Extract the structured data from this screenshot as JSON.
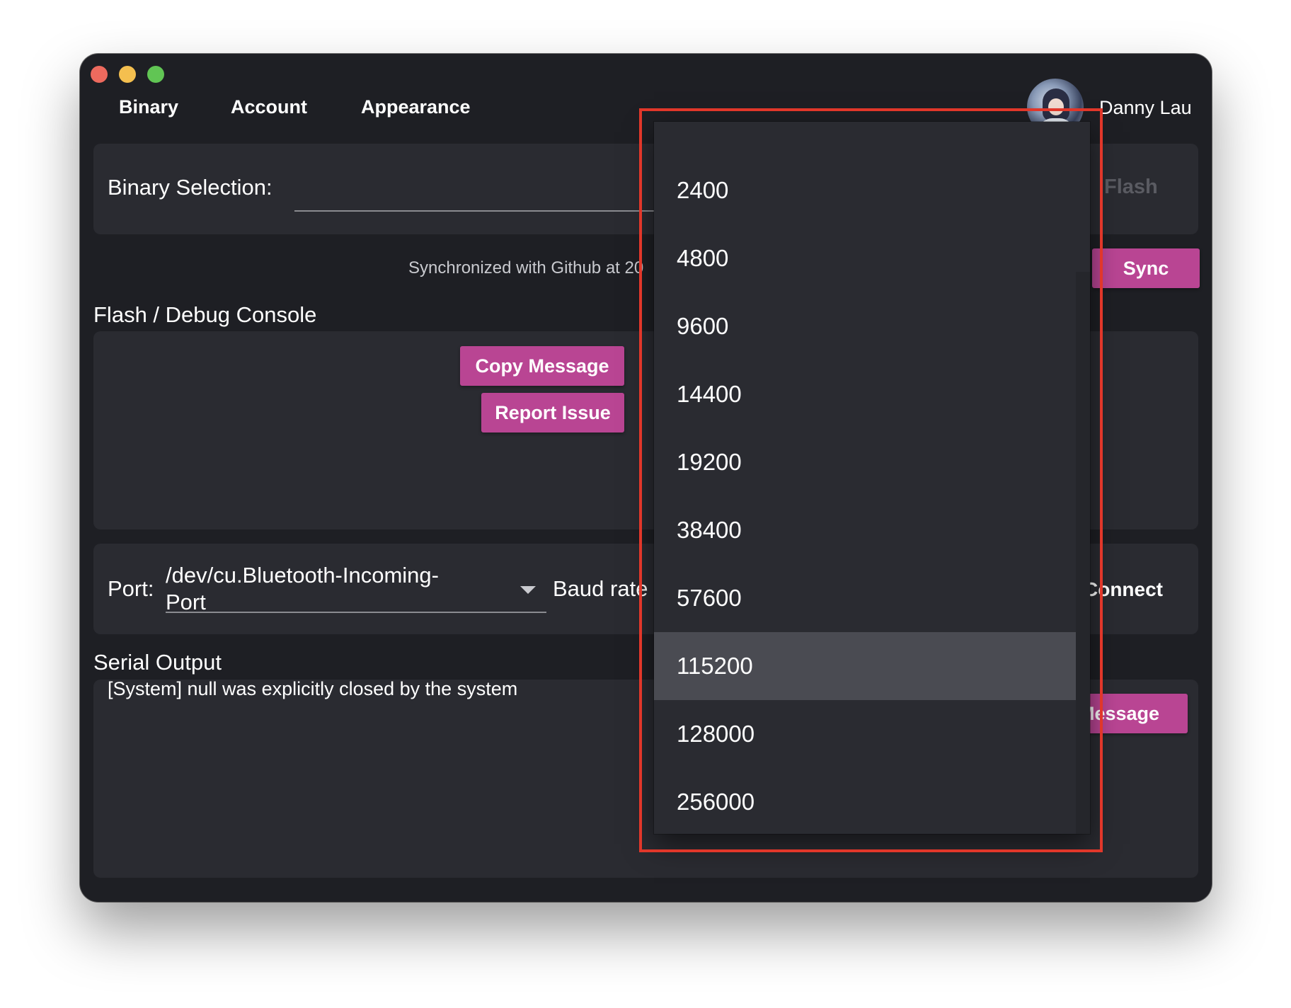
{
  "nav": {
    "tabs": [
      {
        "label": "Binary"
      },
      {
        "label": "Account"
      },
      {
        "label": "Appearance"
      }
    ]
  },
  "user": {
    "name": "Danny Lau",
    "avatar_icon": "user-avatar-icon"
  },
  "binary": {
    "label": "Binary Selection:",
    "value": "",
    "flash_label": "Flash"
  },
  "sync": {
    "text": "Synchronized with Github at 20",
    "button_label": "Sync"
  },
  "console": {
    "title": "Flash / Debug Console",
    "copy_label": "Copy Message",
    "report_label": "Report Issue"
  },
  "port": {
    "label": "Port:",
    "value": "/dev/cu.Bluetooth-Incoming-Port",
    "baud_label": "Baud rate",
    "connect_label": "Connect"
  },
  "serial": {
    "title": "Serial Output",
    "line": "[System] null was explicitly closed by the system",
    "copy_label": "Message"
  },
  "baud_dropdown": {
    "options": [
      "2400",
      "4800",
      "9600",
      "14400",
      "19200",
      "38400",
      "57600",
      "115200",
      "128000",
      "256000"
    ],
    "selected": "115200"
  },
  "colors": {
    "accent": "#b94593",
    "window_bg": "#1e1f24",
    "panel_bg": "#2a2b31",
    "highlight": "#e1372a"
  }
}
